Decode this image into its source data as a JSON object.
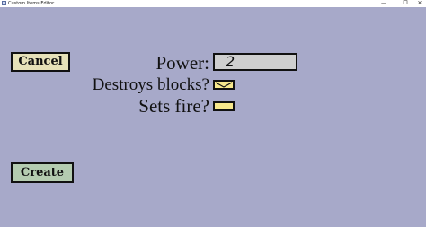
{
  "window": {
    "title": "Custom Items Editor",
    "minimize_glyph": "—",
    "maximize_glyph": "❐",
    "close_glyph": "✕"
  },
  "buttons": {
    "cancel_label": "Cancel",
    "create_label": "Create"
  },
  "form": {
    "power_label": "Power:",
    "power_value": "2",
    "destroys_blocks_label": "Destroys blocks?",
    "destroys_blocks_checked": true,
    "sets_fire_label": "Sets fire?",
    "sets_fire_checked": false
  },
  "colors": {
    "background": "#a7a9c9",
    "cancel_button": "#e6e1b8",
    "create_button": "#b4ccb0",
    "checkbox_fill": "#f7e88c",
    "power_field": "#cfcfcf"
  }
}
